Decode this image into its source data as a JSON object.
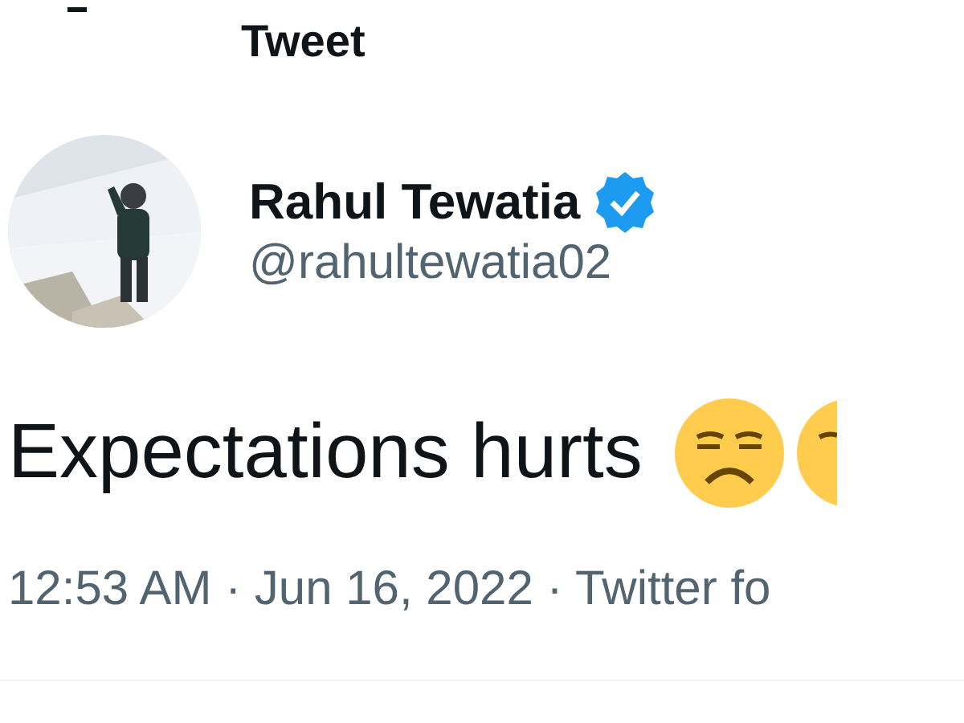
{
  "header": {
    "title": "Tweet"
  },
  "author": {
    "name": "Rahul Tewatia",
    "verified": true,
    "handle": "@rahultewatia02"
  },
  "tweet": {
    "text": "Expectations hurts"
  },
  "meta": {
    "text": "12:53 AM · Jun 16, 2022 · Twitter fo"
  }
}
